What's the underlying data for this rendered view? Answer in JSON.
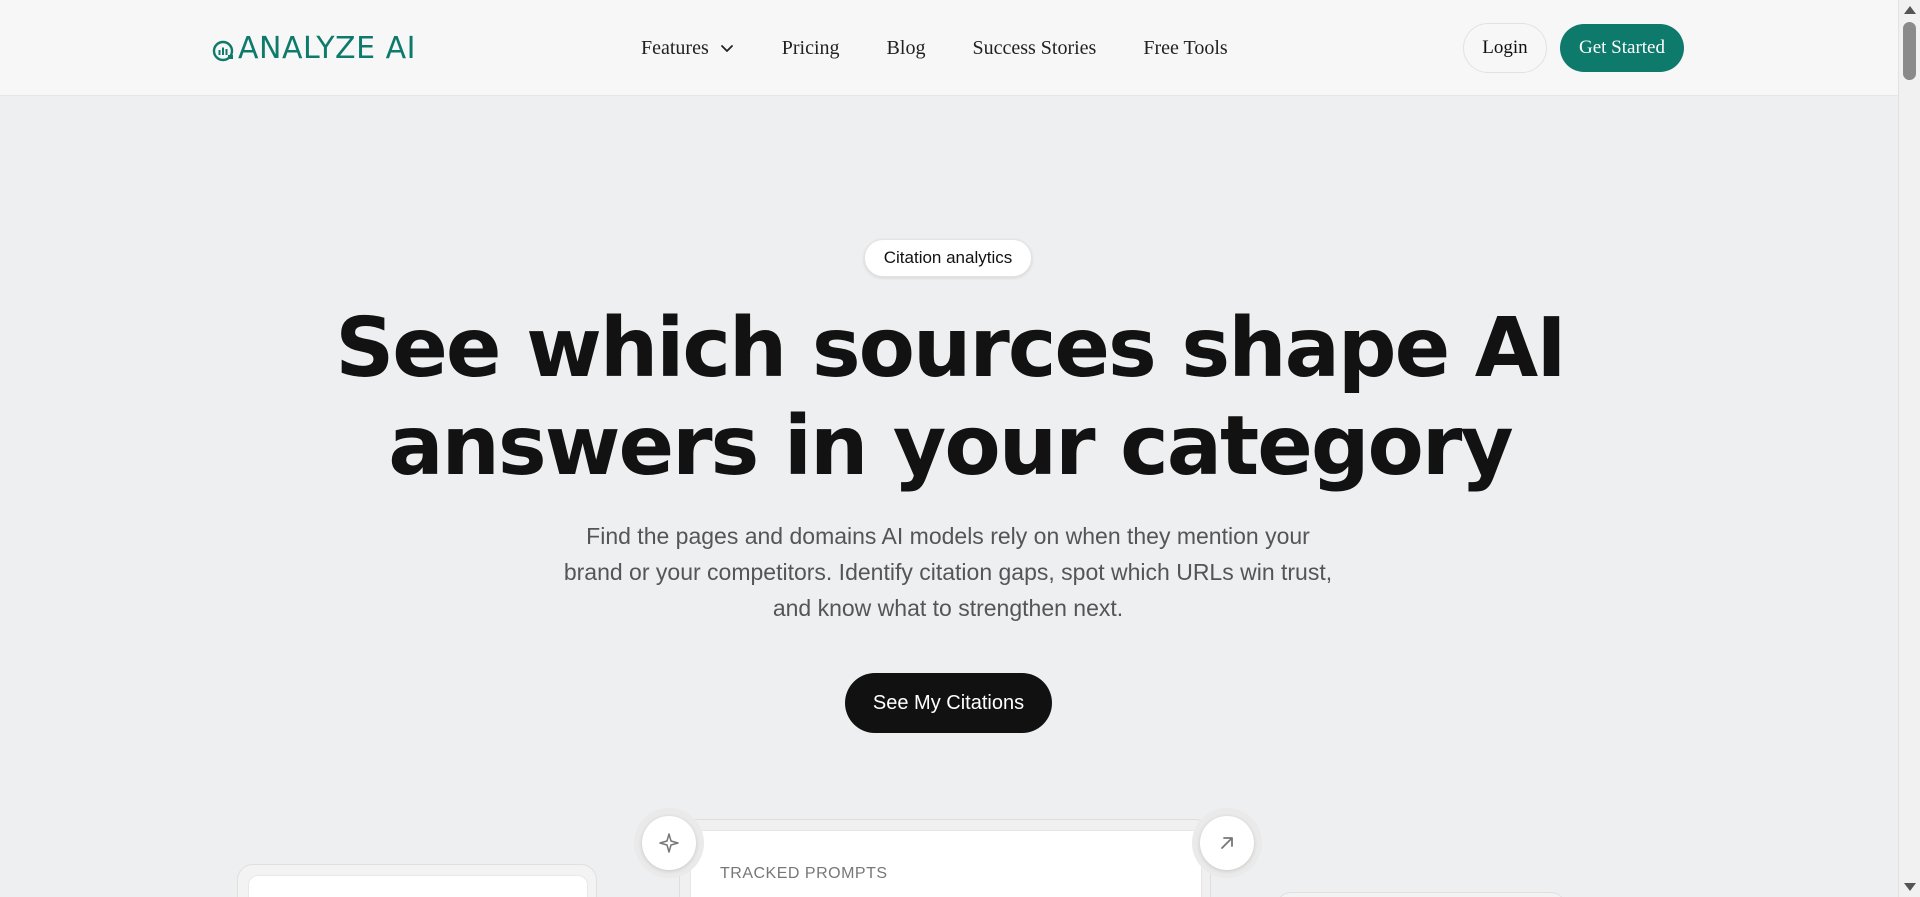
{
  "header": {
    "logo_text": "ANALYZE AI",
    "nav": [
      {
        "label": "Features",
        "has_dropdown": true
      },
      {
        "label": "Pricing"
      },
      {
        "label": "Blog"
      },
      {
        "label": "Success Stories"
      },
      {
        "label": "Free Tools"
      }
    ],
    "login_label": "Login",
    "get_started_label": "Get Started"
  },
  "hero": {
    "badge": "Citation analytics",
    "headline_line1": "See which sources shape AI",
    "headline_line2": "answers in your category",
    "subtext": "Find the pages and domains AI models rely on when they mention your brand or your competitors. Identify citation gaps, spot which URLs win trust, and know what to strengthen next.",
    "cta_label": "See My Citations"
  },
  "preview": {
    "tracked_prompts_label": "TRACKED PROMPTS",
    "left_icon": "sparkle-icon",
    "right_icon": "arrow-up-right-icon"
  },
  "colors": {
    "brand": "#0e7a6c",
    "background": "#eeeff1",
    "cta": "#111111"
  }
}
